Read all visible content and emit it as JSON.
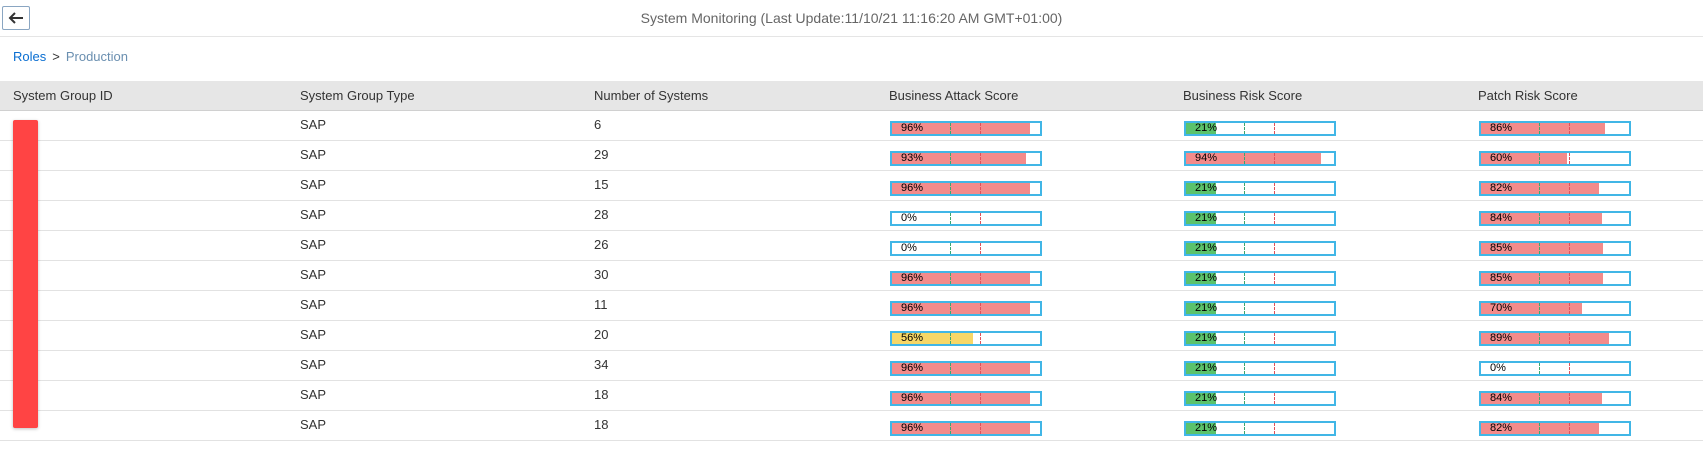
{
  "header": {
    "title": "System Monitoring (Last Update:11/10/21 11:16:20 AM GMT+01:00)",
    "back_icon": "arrow-left-icon"
  },
  "breadcrumb": {
    "link": "Roles",
    "separator": ">",
    "current": "Production"
  },
  "colors": {
    "red": "#f38b8b",
    "yellow": "#f7d767",
    "green": "#5bc36b",
    "bar_border": "#41b6e6"
  },
  "table": {
    "columns": [
      "System Group ID",
      "System Group Type",
      "Number of Systems",
      "Business Attack Score",
      "Business Risk Score",
      "Patch Risk Score"
    ],
    "rows": [
      {
        "id": "",
        "type": "SAP",
        "count": "6",
        "attack": 96,
        "risk": 21,
        "patch": 86
      },
      {
        "id": "",
        "type": "SAP",
        "count": "29",
        "attack": 93,
        "risk": 94,
        "patch": 60
      },
      {
        "id": "",
        "type": "SAP",
        "count": "15",
        "attack": 96,
        "risk": 21,
        "patch": 82
      },
      {
        "id": "",
        "type": "SAP",
        "count": "28",
        "attack": 0,
        "risk": 21,
        "patch": 84
      },
      {
        "id": "",
        "type": "SAP",
        "count": "26",
        "attack": 0,
        "risk": 21,
        "patch": 85
      },
      {
        "id": "",
        "type": "SAP",
        "count": "30",
        "attack": 96,
        "risk": 21,
        "patch": 85
      },
      {
        "id": "",
        "type": "SAP",
        "count": "11",
        "attack": 96,
        "risk": 21,
        "patch": 70
      },
      {
        "id": "",
        "type": "SAP",
        "count": "20",
        "attack": 56,
        "risk": 21,
        "patch": 89
      },
      {
        "id": "",
        "type": "SAP",
        "count": "34",
        "attack": 96,
        "risk": 21,
        "patch": 0
      },
      {
        "id": "",
        "type": "SAP",
        "count": "18",
        "attack": 96,
        "risk": 21,
        "patch": 84
      },
      {
        "id": "",
        "type": "SAP",
        "count": "18",
        "attack": 96,
        "risk": 21,
        "patch": 82
      }
    ]
  }
}
